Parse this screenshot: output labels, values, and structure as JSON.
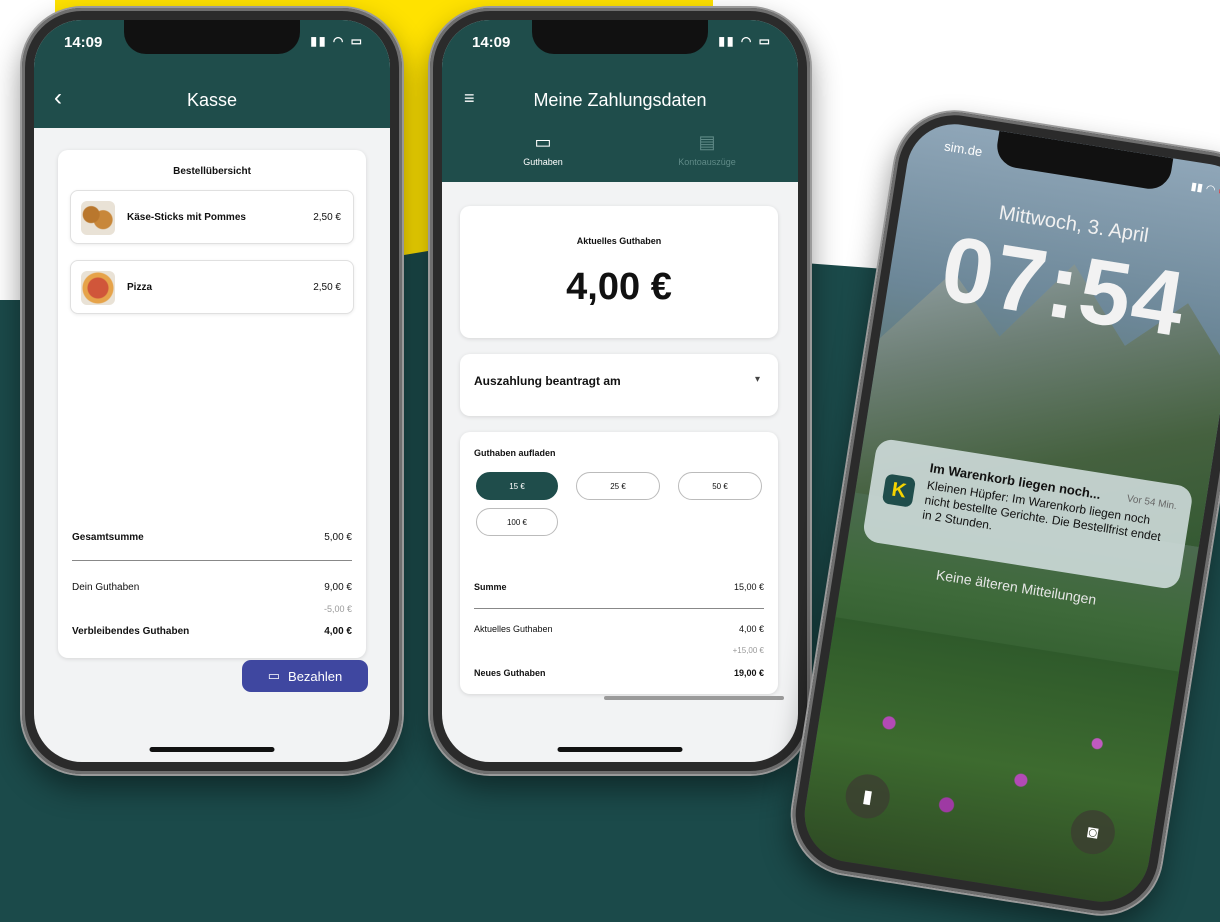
{
  "phone1": {
    "status_time": "14:09",
    "title": "Kasse",
    "order_title": "Bestellübersicht",
    "items": [
      {
        "name": "Käse-Sticks mit Pommes",
        "price": "2,50 €"
      },
      {
        "name": "Pizza",
        "price": "2,50 €"
      }
    ],
    "total_label": "Gesamtsumme",
    "total_value": "5,00 €",
    "balance_label": "Dein Guthaben",
    "balance_value": "9,00 €",
    "deduction": "-5,00 €",
    "remaining_label": "Verbleibendes Guthaben",
    "remaining_value": "4,00 €",
    "pay_label": "Bezahlen"
  },
  "phone2": {
    "status_time": "14:09",
    "title": "Meine Zahlungsdaten",
    "tabs": [
      {
        "label": "Guthaben"
      },
      {
        "label": "Kontoauszüge"
      }
    ],
    "current_label": "Aktuelles Guthaben",
    "current_amount": "4,00 €",
    "payout_label": "Auszahlung beantragt am",
    "topup_label": "Guthaben aufladen",
    "chips": [
      "15 €",
      "25 €",
      "50 €",
      "100 €"
    ],
    "sum_label": "Summe",
    "sum_value": "15,00 €",
    "current_row_label": "Aktuelles Guthaben",
    "current_row_value": "4,00 €",
    "add_value": "+15,00 €",
    "new_label": "Neues Guthaben",
    "new_value": "19,00 €"
  },
  "phone3": {
    "carrier": "sim.de",
    "date": "Mittwoch, 3. April",
    "time": "07:54",
    "notification": {
      "title": "Im Warenkorb liegen noch...",
      "time": "Vor 54 Min.",
      "body": "Kleinen Hüpfer: Im Warenkorb liegen noch nicht bestellte Gerichte. Die Bestellfrist endet in 2 Stunden.",
      "icon_letter": "K"
    },
    "no_older": "Keine älteren Mitteilungen"
  },
  "colors": {
    "teal": "#1f4d4b",
    "yellow": "#ffe200",
    "button_blue": "#3f47a0"
  }
}
